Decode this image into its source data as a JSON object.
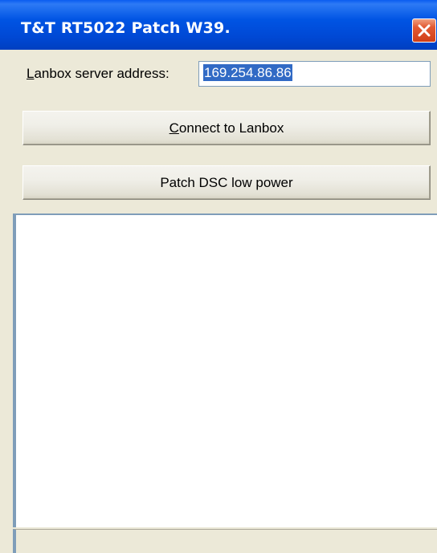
{
  "window": {
    "title": "T&T RT5022 Patch W39."
  },
  "form": {
    "address_label_accel": "L",
    "address_label_rest": "anbox server address:",
    "address_value": "169.254.86.86"
  },
  "buttons": {
    "connect_accel": "C",
    "connect_rest": "onnect to Lanbox",
    "patch_label": "Patch DSC low power"
  },
  "colors": {
    "titlebar": "#0054e3",
    "close_button": "#e35a33",
    "selection": "#316ac5",
    "face": "#ece9d8",
    "input_border": "#7f9db9"
  },
  "icons": {
    "close": "close-x-icon"
  }
}
